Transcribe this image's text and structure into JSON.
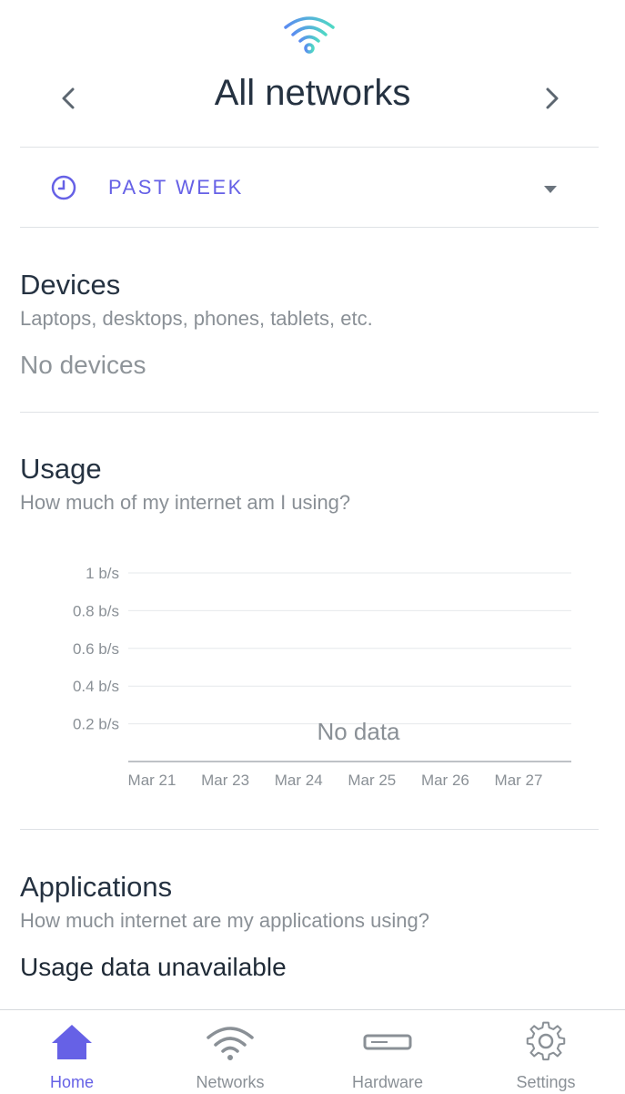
{
  "header": {
    "title": "All networks",
    "logo_icon": "wifi-logo-icon",
    "prev_icon": "chevron-left-icon",
    "next_icon": "chevron-right-icon"
  },
  "time_range": {
    "label": "PAST WEEK",
    "icon": "clock-icon",
    "dropdown_icon": "caret-down-icon",
    "accent_color": "#6661e6"
  },
  "devices": {
    "title": "Devices",
    "subtitle": "Laptops, desktops, phones, tablets, etc.",
    "empty_text": "No devices"
  },
  "usage": {
    "title": "Usage",
    "subtitle": "How much of my internet am I using?"
  },
  "chart_data": {
    "type": "line",
    "y_ticks": [
      "0.2 b/s",
      "0.4 b/s",
      "0.6 b/s",
      "0.8 b/s",
      "1 b/s"
    ],
    "x_ticks": [
      "Mar 21",
      "Mar 23",
      "Mar 24",
      "Mar 25",
      "Mar 26",
      "Mar 27"
    ],
    "ylim": [
      0,
      1
    ],
    "series": [],
    "annotation": "No data",
    "grid": true
  },
  "applications": {
    "title": "Applications",
    "subtitle": "How much internet are my applications using?",
    "status_text": "Usage data unavailable"
  },
  "tabbar": {
    "active_color": "#6661e6",
    "inactive_color": "#8a9096",
    "tabs": [
      {
        "label": "Home",
        "icon": "home-icon",
        "active": true
      },
      {
        "label": "Networks",
        "icon": "wifi-icon",
        "active": false
      },
      {
        "label": "Hardware",
        "icon": "router-icon",
        "active": false
      },
      {
        "label": "Settings",
        "icon": "gear-icon",
        "active": false
      }
    ]
  }
}
